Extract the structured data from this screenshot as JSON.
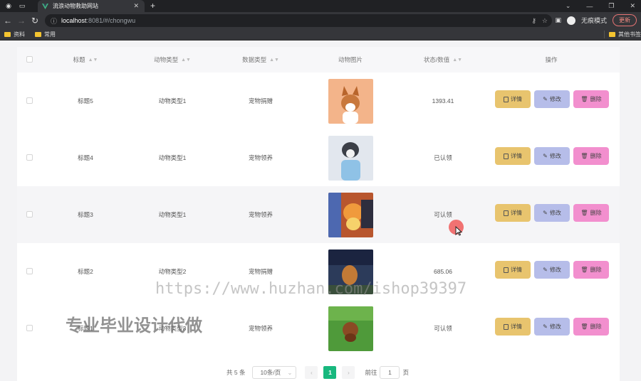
{
  "browser": {
    "tab_title": "流浪动物救助网站",
    "url_host": "localhost",
    "url_path": ":8081/#/chongwu",
    "profile_label": "无痕模式",
    "update_label": "更新",
    "bookmarks": [
      "资料",
      "常用"
    ],
    "other_bookmarks": "其他书签"
  },
  "table": {
    "headers": [
      "标题",
      "动物类型",
      "数据类型",
      "动物图片",
      "状态/数值",
      "操作"
    ],
    "rows": [
      {
        "title": "标题5",
        "animal_type": "动物类型1",
        "data_type": "宠物捐赠",
        "status": "1393.41",
        "img": "corgi"
      },
      {
        "title": "标题4",
        "animal_type": "动物类型1",
        "data_type": "宠物领养",
        "status": "已认领",
        "img": "husky"
      },
      {
        "title": "标题3",
        "animal_type": "动物类型1",
        "data_type": "宠物领养",
        "status": "可认领",
        "img": "pomeranian"
      },
      {
        "title": "标题2",
        "animal_type": "动物类型2",
        "data_type": "宠物捐赠",
        "status": "685.06",
        "img": "dog-night"
      },
      {
        "title": "标题1",
        "animal_type": "动物类型3",
        "data_type": "宠物领养",
        "status": "可认领",
        "img": "dog-grass"
      }
    ],
    "actions": {
      "detail": "详情",
      "edit": "修改",
      "delete": "删除"
    }
  },
  "pagination": {
    "total_text": "共 5 条",
    "page_size": "10条/页",
    "current_page": "1",
    "goto_label": "前往",
    "goto_value": "1",
    "page_unit": "页"
  },
  "watermark": {
    "url": "https://www.huzhan.com/ishop39397",
    "text": "专业毕业设计代做"
  },
  "colors": {
    "detail": "#e8c46e",
    "edit": "#b6bde9",
    "delete": "#f28fce",
    "active_page": "#18b87e"
  }
}
